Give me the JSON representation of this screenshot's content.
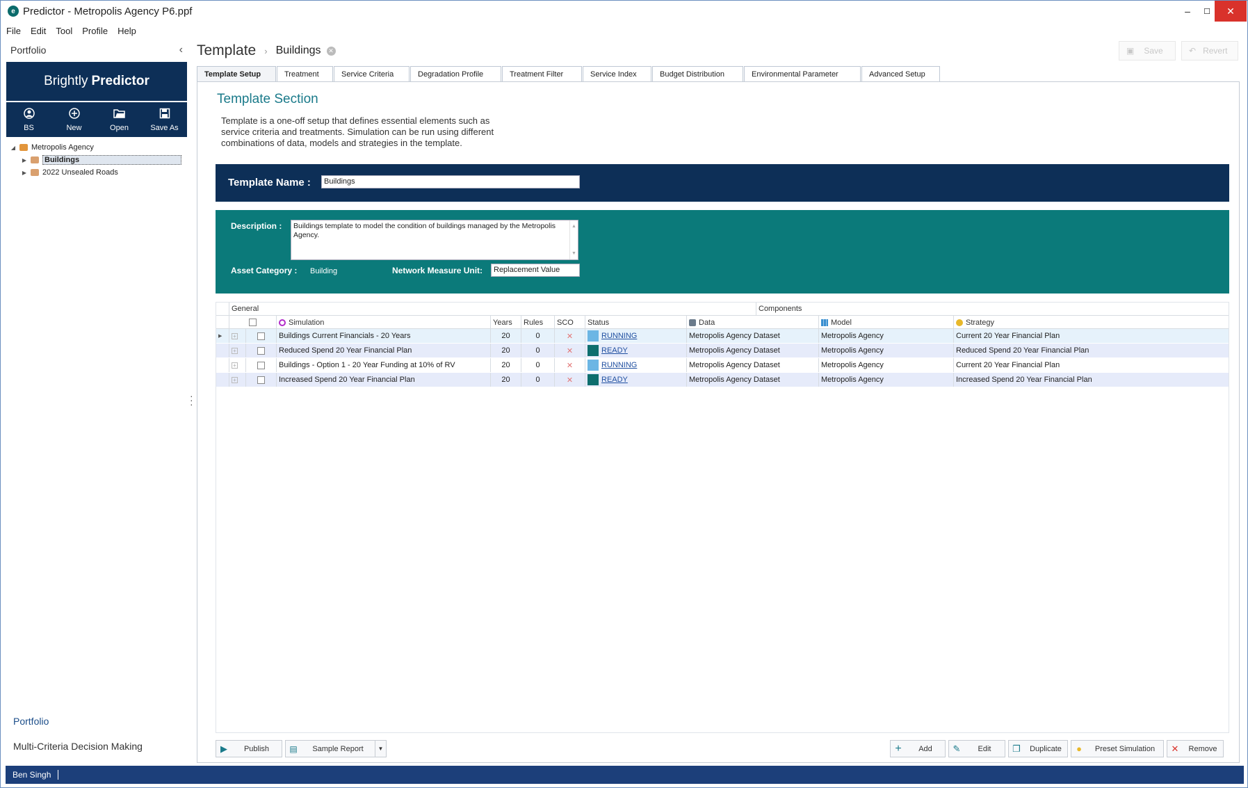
{
  "window": {
    "title": "Predictor - Metropolis Agency P6.ppf",
    "controls": {
      "minimize": "–",
      "maximize": "☐",
      "close": "✕"
    }
  },
  "menu": [
    "File",
    "Edit",
    "Tool",
    "Profile",
    "Help"
  ],
  "sidebar": {
    "header": "Portfolio",
    "brand_light": "Brightly",
    "brand_bold": "Predictor",
    "tools": [
      {
        "label": "BS",
        "icon": "user-icon"
      },
      {
        "label": "New",
        "icon": "plus-circle-icon"
      },
      {
        "label": "Open",
        "icon": "folder-open-icon"
      },
      {
        "label": "Save As",
        "icon": "save-icon"
      }
    ],
    "tree": {
      "root": "Metropolis Agency",
      "children": [
        "Buildings",
        "2022 Unsealed Roads"
      ]
    },
    "bottom_items": [
      "Portfolio",
      "Multi-Criteria Decision Making"
    ]
  },
  "breadcrumb": {
    "section": "Template",
    "item": "Buildings"
  },
  "toolbar": {
    "save": "Save",
    "revert": "Revert"
  },
  "tabs": [
    "Template Setup",
    "Treatment",
    "Service Criteria",
    "Degradation Profile",
    "Treatment Filter",
    "Service Index",
    "Budget Distribution",
    "Environmental Parameter",
    "Advanced Setup"
  ],
  "section": {
    "title": "Template Section",
    "description": "Template is a one-off setup that defines essential elements such as service criteria and treatments. Simulation can be run using different combinations of data, models and strategies in the template."
  },
  "form": {
    "template_name_label": "Template Name :",
    "template_name": "Buildings",
    "description_label": "Description :",
    "description": "Buildings template to model the condition of buildings managed by the Metropolis Agency.",
    "asset_category_label": "Asset Category :",
    "asset_category": "Building",
    "network_unit_label": "Network Measure Unit:",
    "network_unit": "Replacement Value"
  },
  "grid": {
    "groups": {
      "general": "General",
      "components": "Components"
    },
    "columns": {
      "simulation": "Simulation",
      "years": "Years",
      "rules": "Rules",
      "sco": "SCO",
      "status": "Status",
      "data": "Data",
      "model": "Model",
      "strategy": "Strategy"
    },
    "rows": [
      {
        "simulation": "Buildings Current Financials - 20 Years",
        "years": "20",
        "rules": "0",
        "sco": "✕",
        "status": "RUNNING",
        "status_color": "#6cb6e4",
        "data": "Metropolis Agency Dataset",
        "model": "Metropolis Agency",
        "strategy": "Current 20 Year Financial Plan"
      },
      {
        "simulation": "Reduced Spend 20 Year Financial Plan",
        "years": "20",
        "rules": "0",
        "sco": "✕",
        "status": "READY",
        "status_color": "#0e6e6e",
        "data": "Metropolis Agency Dataset",
        "model": "Metropolis Agency",
        "strategy": "Reduced Spend 20 Year Financial Plan"
      },
      {
        "simulation": "Buildings - Option 1 - 20 Year Funding at 10% of RV",
        "years": "20",
        "rules": "0",
        "sco": "✕",
        "status": "RUNNING",
        "status_color": "#6cb6e4",
        "data": "Metropolis Agency Dataset",
        "model": "Metropolis Agency",
        "strategy": "Current 20 Year Financial Plan"
      },
      {
        "simulation": "Increased Spend 20 Year Financial Plan",
        "years": "20",
        "rules": "0",
        "sco": "✕",
        "status": "READY",
        "status_color": "#0e6e6e",
        "data": "Metropolis Agency Dataset",
        "model": "Metropolis Agency",
        "strategy": "Increased Spend 20 Year Financial Plan"
      }
    ]
  },
  "actions": {
    "publish": "Publish",
    "sample_report": "Sample Report",
    "add": "Add",
    "edit": "Edit",
    "duplicate": "Duplicate",
    "preset_simulation": "Preset Simulation",
    "remove": "Remove"
  },
  "statusbar": {
    "user": "Ben Singh"
  },
  "colors": {
    "navy": "#0d2f57",
    "teal": "#0b7a7a",
    "status_bar": "#1c3f7a"
  }
}
